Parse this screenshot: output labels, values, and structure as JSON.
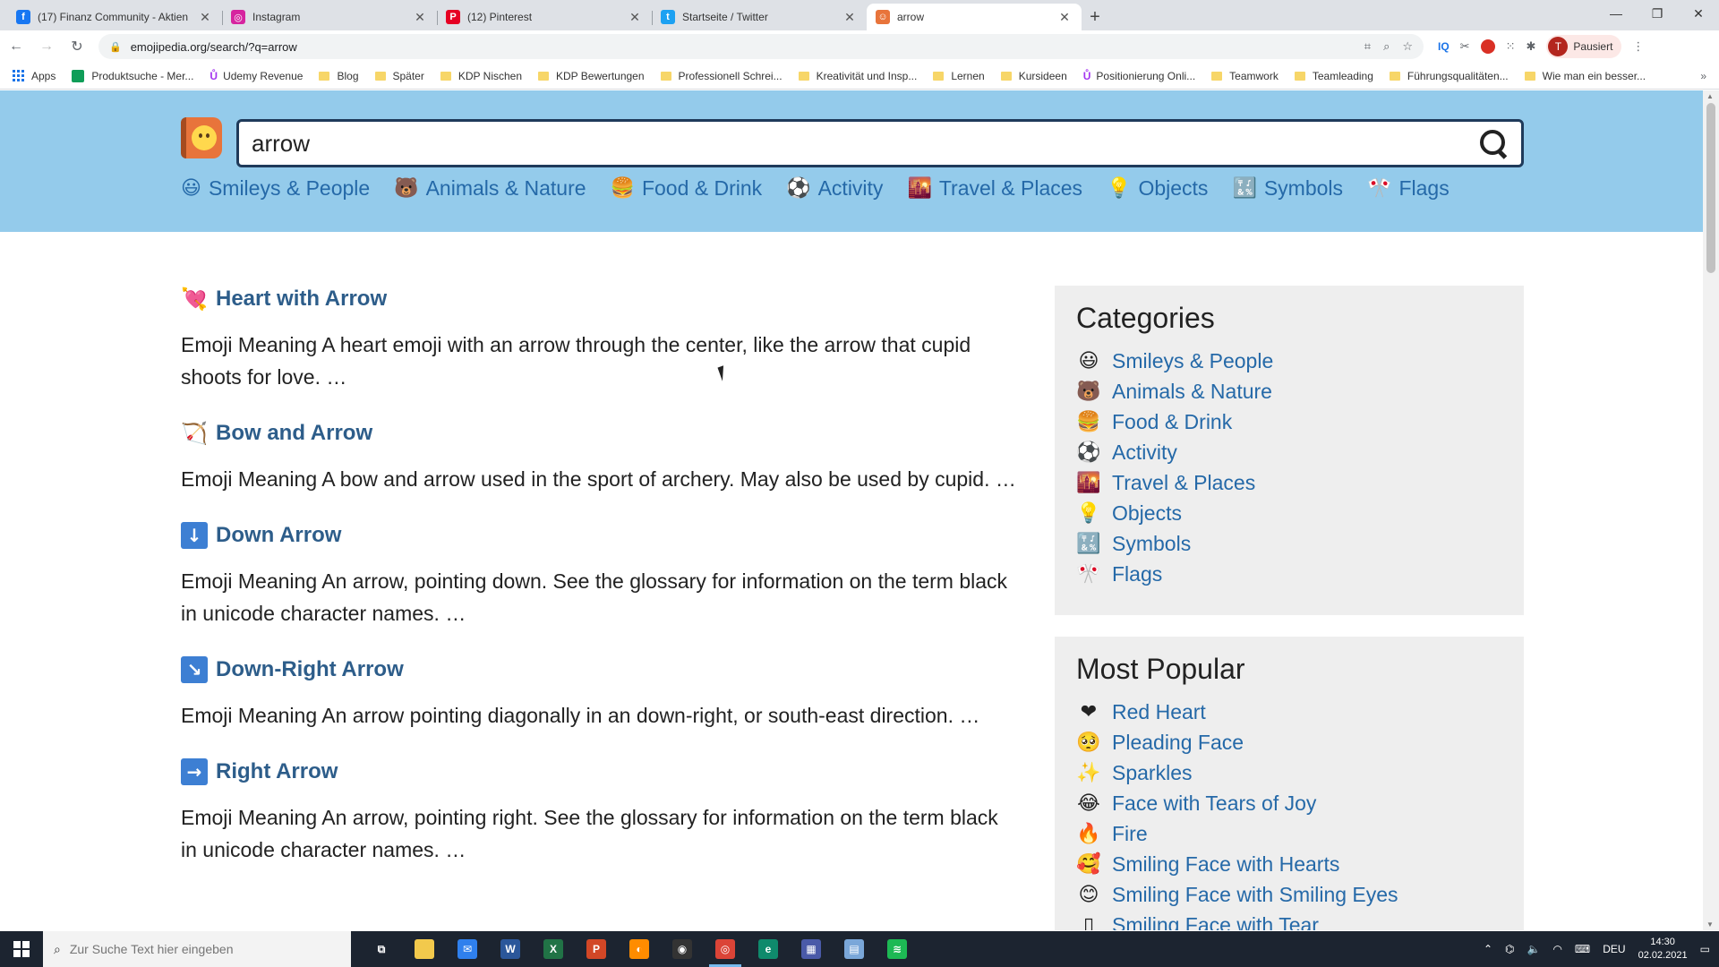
{
  "browser": {
    "tabs": [
      {
        "title": "(17) Finanz Community - Aktien",
        "favicon": "facebook-icon",
        "color": "#1877f2",
        "glyph": "f",
        "active": false
      },
      {
        "title": "Instagram",
        "favicon": "instagram-icon",
        "color": "#d6249f",
        "glyph": "◎",
        "active": false
      },
      {
        "title": "(12) Pinterest",
        "favicon": "pinterest-icon",
        "color": "#e60023",
        "glyph": "P",
        "active": false
      },
      {
        "title": "Startseite / Twitter",
        "favicon": "twitter-icon",
        "color": "#1da1f2",
        "glyph": "t",
        "active": false
      },
      {
        "title": "arrow",
        "favicon": "emojipedia-icon",
        "color": "#e8743b",
        "glyph": "☺",
        "active": true
      }
    ],
    "url": "emojipedia.org/search/?q=arrow",
    "profile_label": "Pausiert",
    "profile_initial": "T",
    "bookmarks": [
      {
        "label": "Apps",
        "type": "apps"
      },
      {
        "label": "Produktsuche - Mer...",
        "type": "green"
      },
      {
        "label": "Udemy Revenue",
        "type": "udemy"
      },
      {
        "label": "Blog",
        "type": "folder"
      },
      {
        "label": "Später",
        "type": "folder"
      },
      {
        "label": "KDP Nischen",
        "type": "folder"
      },
      {
        "label": "KDP Bewertungen",
        "type": "folder"
      },
      {
        "label": "Professionell Schrei...",
        "type": "folder"
      },
      {
        "label": "Kreativität und Insp...",
        "type": "folder"
      },
      {
        "label": "Lernen",
        "type": "folder"
      },
      {
        "label": "Kursideen",
        "type": "folder"
      },
      {
        "label": "Positionierung Onli...",
        "type": "udemy"
      },
      {
        "label": "Teamwork",
        "type": "folder"
      },
      {
        "label": "Teamleading",
        "type": "folder"
      },
      {
        "label": "Führungsqualitäten...",
        "type": "folder"
      },
      {
        "label": "Wie man ein besser...",
        "type": "folder"
      }
    ]
  },
  "site": {
    "search_value": "arrow",
    "nav": [
      {
        "label": "Smileys & People",
        "icon": "😃"
      },
      {
        "label": "Animals & Nature",
        "icon": "🐻"
      },
      {
        "label": "Food & Drink",
        "icon": "🍔"
      },
      {
        "label": "Activity",
        "icon": "⚽"
      },
      {
        "label": "Travel & Places",
        "icon": "🌇"
      },
      {
        "label": "Objects",
        "icon": "💡"
      },
      {
        "label": "Symbols",
        "icon": "🔣"
      },
      {
        "label": "Flags",
        "icon": "🎌"
      }
    ]
  },
  "results": [
    {
      "title": "Heart with Arrow",
      "icon": "💘",
      "boxed": false,
      "text": "Emoji Meaning A heart emoji with an arrow through the center, like the arrow that cupid shoots for love. …"
    },
    {
      "title": "Bow and Arrow",
      "icon": "🏹",
      "boxed": false,
      "text": "Emoji Meaning A bow and arrow used in the sport of archery. May also be used by cupid. …"
    },
    {
      "title": "Down Arrow",
      "icon": "↓",
      "boxed": true,
      "text": "Emoji Meaning An arrow, pointing down. See the glossary for information on the term black in unicode character names. …"
    },
    {
      "title": "Down-Right Arrow",
      "icon": "↘",
      "boxed": true,
      "text": "Emoji Meaning An arrow pointing diagonally in an down-right, or south-east direction. …"
    },
    {
      "title": "Right Arrow",
      "icon": "→",
      "boxed": true,
      "text": "Emoji Meaning An arrow, pointing right. See the glossary for information on the term black in unicode character names. …"
    }
  ],
  "sidebar": {
    "categories_title": "Categories",
    "categories": [
      {
        "label": "Smileys & People",
        "icon": "😃"
      },
      {
        "label": "Animals & Nature",
        "icon": "🐻"
      },
      {
        "label": "Food & Drink",
        "icon": "🍔"
      },
      {
        "label": "Activity",
        "icon": "⚽"
      },
      {
        "label": "Travel & Places",
        "icon": "🌇"
      },
      {
        "label": "Objects",
        "icon": "💡"
      },
      {
        "label": "Symbols",
        "icon": "🔣"
      },
      {
        "label": "Flags",
        "icon": "🎌"
      }
    ],
    "popular_title": "Most Popular",
    "popular": [
      {
        "label": "Red Heart",
        "icon": "❤"
      },
      {
        "label": "Pleading Face",
        "icon": "🥺"
      },
      {
        "label": "Sparkles",
        "icon": "✨"
      },
      {
        "label": "Face with Tears of Joy",
        "icon": "😂"
      },
      {
        "label": "Fire",
        "icon": "🔥"
      },
      {
        "label": "Smiling Face with Hearts",
        "icon": "🥰"
      },
      {
        "label": "Smiling Face with Smiling Eyes",
        "icon": "😊"
      },
      {
        "label": "Smiling Face with Tear",
        "icon": "▯"
      }
    ]
  },
  "taskbar": {
    "search_placeholder": "Zur Suche Text hier eingeben",
    "language": "DEU",
    "time": "14:30",
    "date": "02.02.2021",
    "apps": [
      {
        "name": "task-view-icon",
        "color": "transparent",
        "glyph": "⧉"
      },
      {
        "name": "file-explorer-icon",
        "color": "#f2c94c",
        "glyph": ""
      },
      {
        "name": "mail-icon",
        "color": "#2f80ed",
        "glyph": "✉"
      },
      {
        "name": "word-icon",
        "color": "#2b579a",
        "glyph": "W"
      },
      {
        "name": "excel-icon",
        "color": "#217346",
        "glyph": "X"
      },
      {
        "name": "powerpoint-icon",
        "color": "#d24726",
        "glyph": "P"
      },
      {
        "name": "app-icon",
        "color": "#ff8c00",
        "glyph": "◐"
      },
      {
        "name": "obs-icon",
        "color": "#333333",
        "glyph": "◉"
      },
      {
        "name": "chrome-icon",
        "color": "#db4437",
        "glyph": "◎",
        "active": true
      },
      {
        "name": "edge-icon",
        "color": "#0f8a6c",
        "glyph": "e"
      },
      {
        "name": "calculator-icon",
        "color": "#4a5aa8",
        "glyph": "▦"
      },
      {
        "name": "notepad-icon",
        "color": "#7aa7d9",
        "glyph": "▤"
      },
      {
        "name": "spotify-icon",
        "color": "#1db954",
        "glyph": "≋"
      }
    ]
  }
}
